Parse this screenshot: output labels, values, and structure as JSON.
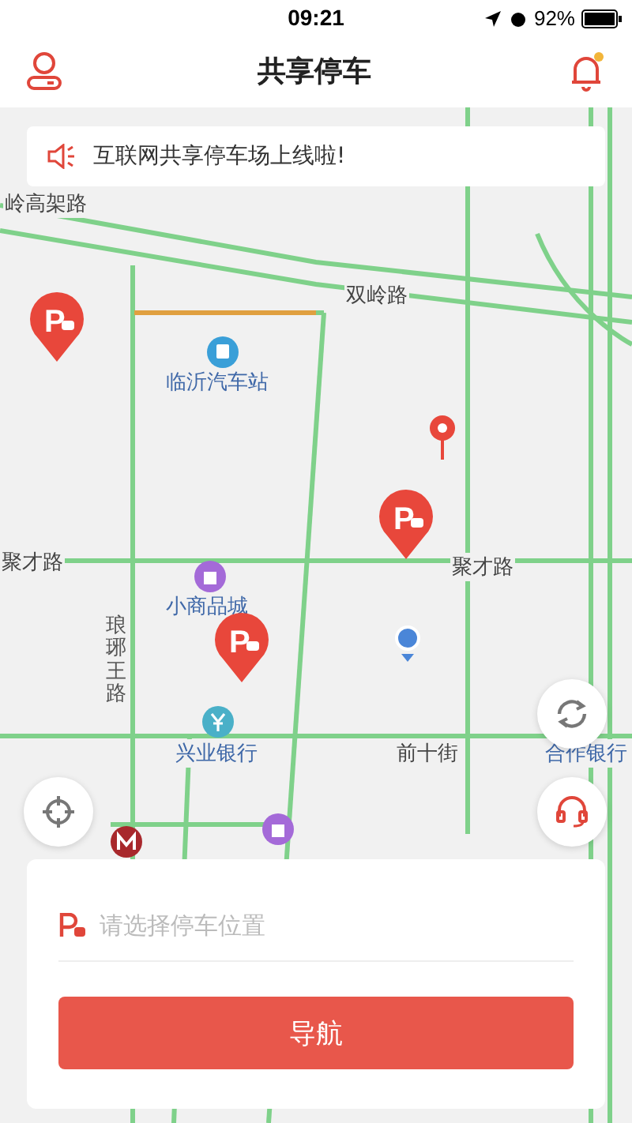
{
  "status_bar": {
    "time": "09:21",
    "battery": "92%"
  },
  "header": {
    "title": "共享停车"
  },
  "notice": {
    "text": "互联网共享停车场上线啦!"
  },
  "map": {
    "labels": [
      {
        "text": "岭高架路",
        "kind": "road"
      },
      {
        "text": "双岭路",
        "kind": "road"
      },
      {
        "text": "临沂汽车站",
        "kind": "place"
      },
      {
        "text": "聚才路",
        "kind": "road"
      },
      {
        "text": "聚才路",
        "kind": "road"
      },
      {
        "text": "小商品城",
        "kind": "place"
      },
      {
        "text": "琅琊王路",
        "kind": "vertical"
      },
      {
        "text": "兴业银行",
        "kind": "place"
      },
      {
        "text": "前十街",
        "kind": "road"
      },
      {
        "text": "合作银行",
        "kind": "place"
      }
    ]
  },
  "parking_pins": [
    {
      "symbol": "P"
    },
    {
      "symbol": "P"
    },
    {
      "symbol": "P"
    }
  ],
  "parking_form": {
    "placeholder": "请选择停车位置",
    "button": "导航"
  }
}
